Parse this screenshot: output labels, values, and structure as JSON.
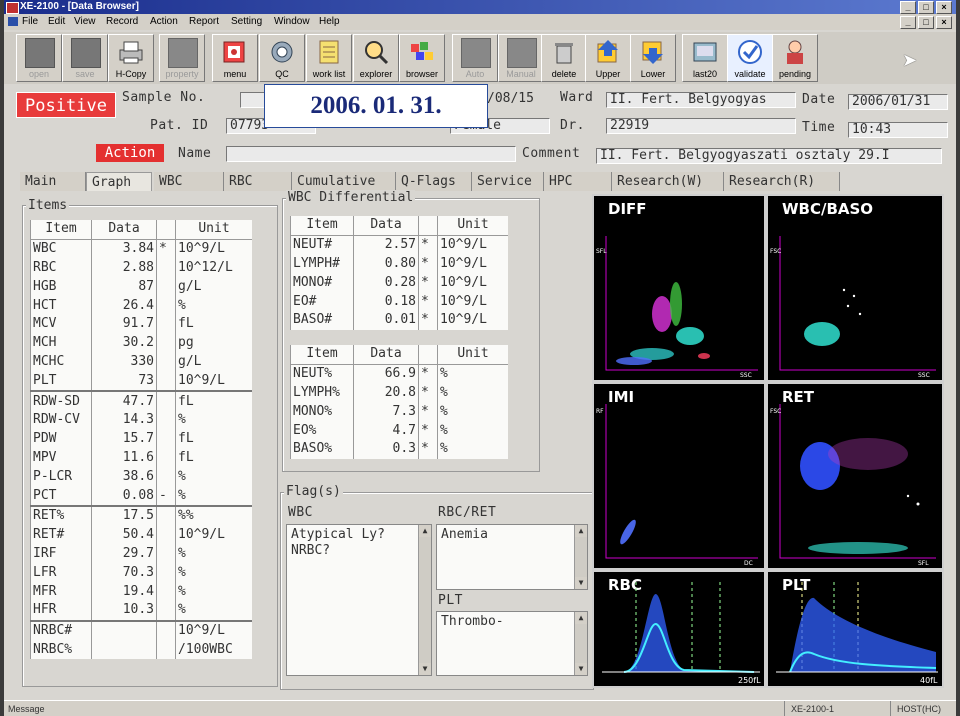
{
  "window": {
    "title": "XE-2100 - [Data Browser]"
  },
  "menu": [
    "File",
    "Edit",
    "View",
    "Record",
    "Action",
    "Report",
    "Setting",
    "Window",
    "Help"
  ],
  "toolbar": [
    {
      "label": "open",
      "icon": "open-icon",
      "enabled": false
    },
    {
      "label": "save",
      "icon": "save-icon",
      "enabled": false
    },
    {
      "label": "H-Copy",
      "icon": "printer-icon",
      "enabled": true
    },
    {
      "label": "property",
      "icon": "property-icon",
      "enabled": false
    },
    {
      "label": "menu",
      "icon": "menu-icon",
      "enabled": true
    },
    {
      "label": "QC",
      "icon": "qc-icon",
      "enabled": true
    },
    {
      "label": "work list",
      "icon": "worklist-icon",
      "enabled": true
    },
    {
      "label": "explorer",
      "icon": "explorer-icon",
      "enabled": true
    },
    {
      "label": "browser",
      "icon": "browser-icon",
      "enabled": true
    },
    {
      "label": "Auto",
      "icon": "auto-icon",
      "enabled": false
    },
    {
      "label": "Manual",
      "icon": "manual-icon",
      "enabled": false
    },
    {
      "label": "delete",
      "icon": "trash-icon",
      "enabled": true
    },
    {
      "label": "Upper",
      "icon": "upper-icon",
      "enabled": true
    },
    {
      "label": "Lower",
      "icon": "lower-icon",
      "enabled": true
    },
    {
      "label": "last20",
      "icon": "last20-icon",
      "enabled": true
    },
    {
      "label": "validate",
      "icon": "validate-icon",
      "enabled": true
    },
    {
      "label": "pending",
      "icon": "pending-icon",
      "enabled": true
    }
  ],
  "header": {
    "status_badge": "Positive",
    "action_badge": "Action",
    "sample_no_label": "Sample No.",
    "sample_no_value": "",
    "date_partial": "/08/15",
    "ward_label": "Ward",
    "ward_value": "II. Fert. Belgyogyas",
    "date_label": "Date",
    "date_value": "2006/01/31",
    "pat_id_label": "Pat. ID",
    "pat_id_value": "07793",
    "sex_value": "Female",
    "dr_label": "Dr.",
    "dr_value": "22919",
    "time_label": "Time",
    "time_value": "10:43",
    "name_label": "Name",
    "name_value": "",
    "comment_label": "Comment",
    "comment_value": "II. Fert. Belgyogyaszati osztaly 29.I",
    "overlay_date": "2006. 01. 31."
  },
  "tabs": [
    "Main",
    "Graph",
    "WBC",
    "RBC",
    "Cumulative",
    "Q-Flags",
    "Service",
    "HPC",
    "Research(W)",
    "Research(R)"
  ],
  "items": {
    "group_title": "Items",
    "headers": [
      "Item",
      "Data",
      "",
      "Unit"
    ],
    "rows": [
      [
        "WBC",
        "3.84",
        "*",
        "10^9/L"
      ],
      [
        "RBC",
        "2.88",
        "",
        "10^12/L"
      ],
      [
        "HGB",
        "87",
        "",
        "g/L"
      ],
      [
        "HCT",
        "26.4",
        "",
        "%"
      ],
      [
        "MCV",
        "91.7",
        "",
        "fL"
      ],
      [
        "MCH",
        "30.2",
        "",
        "pg"
      ],
      [
        "MCHC",
        "330",
        "",
        "g/L"
      ],
      [
        "PLT",
        "73",
        "",
        "10^9/L"
      ],
      [
        "RDW-SD",
        "47.7",
        "",
        "fL"
      ],
      [
        "RDW-CV",
        "14.3",
        "",
        "%"
      ],
      [
        "PDW",
        "15.7",
        "",
        "fL"
      ],
      [
        "MPV",
        "11.6",
        "",
        "fL"
      ],
      [
        "P-LCR",
        "38.6",
        "",
        "%"
      ],
      [
        "PCT",
        "0.08",
        "-",
        "%"
      ],
      [
        "RET%",
        "17.5",
        "",
        "%%"
      ],
      [
        "RET#",
        "50.4",
        "",
        "10^9/L"
      ],
      [
        "IRF",
        "29.7",
        "",
        "%"
      ],
      [
        "LFR",
        "70.3",
        "",
        "%"
      ],
      [
        "MFR",
        "19.4",
        "",
        "%"
      ],
      [
        "HFR",
        "10.3",
        "",
        "%"
      ],
      [
        "NRBC#",
        "",
        "",
        "10^9/L"
      ],
      [
        "NRBC%",
        "",
        "",
        "/100WBC"
      ]
    ]
  },
  "wbc_diff": {
    "group_title": "WBC Differential",
    "headers": [
      "Item",
      "Data",
      "",
      "Unit"
    ],
    "abs_rows": [
      [
        "NEUT#",
        "2.57",
        "*",
        "10^9/L"
      ],
      [
        "LYMPH#",
        "0.80",
        "*",
        "10^9/L"
      ],
      [
        "MONO#",
        "0.28",
        "*",
        "10^9/L"
      ],
      [
        "EO#",
        "0.18",
        "*",
        "10^9/L"
      ],
      [
        "BASO#",
        "0.01",
        "*",
        "10^9/L"
      ]
    ],
    "pct_rows": [
      [
        "NEUT%",
        "66.9",
        "*",
        "%"
      ],
      [
        "LYMPH%",
        "20.8",
        "*",
        "%"
      ],
      [
        "MONO%",
        "7.3",
        "*",
        "%"
      ],
      [
        "EO%",
        "4.7",
        "*",
        "%"
      ],
      [
        "BASO%",
        "0.3",
        "*",
        "%"
      ]
    ]
  },
  "flags": {
    "group_title": "Flag(s)",
    "wbc_label": "WBC",
    "wbc_flags": [
      "Atypical Ly?",
      "NRBC?"
    ],
    "rbc_label": "RBC/RET",
    "rbc_flags": [
      "Anemia"
    ],
    "plt_label": "PLT",
    "plt_flags": [
      "Thrombo-"
    ]
  },
  "plots": {
    "diff": {
      "title": "DIFF",
      "y": "SFL",
      "x": "SSC"
    },
    "wbcbaso": {
      "title": "WBC/BASO",
      "y": "FSC",
      "x": "SSC"
    },
    "imi": {
      "title": "IMI",
      "y": "RF",
      "x": "DC"
    },
    "ret": {
      "title": "RET",
      "y": "FSC",
      "x": "SFL"
    },
    "rbc": {
      "title": "RBC",
      "x": "250fL"
    },
    "plt": {
      "title": "PLT",
      "x": "40fL"
    }
  },
  "statusbar": {
    "message": "Message",
    "panel1": "XE-2100-1",
    "panel2": "HOST(HC)"
  }
}
